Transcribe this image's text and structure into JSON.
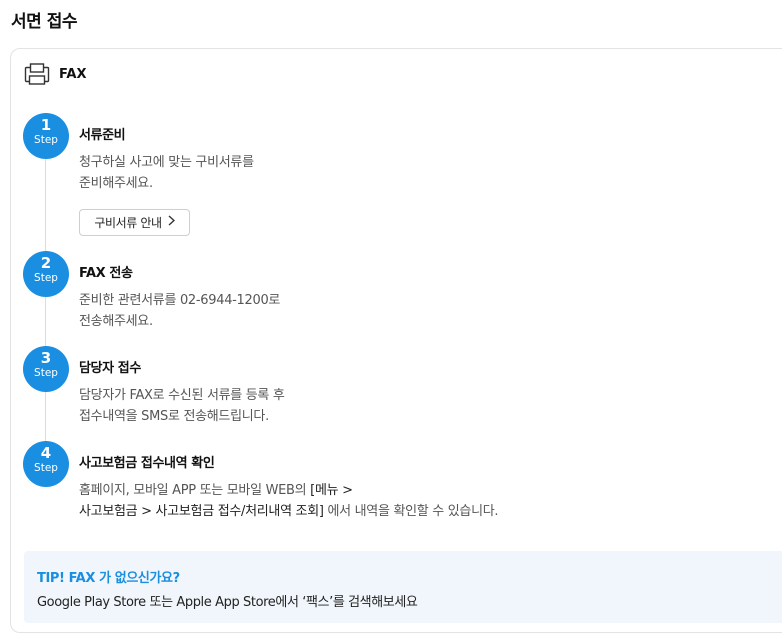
{
  "page": {
    "title": "서면 접수"
  },
  "fax": {
    "title": "FAX",
    "icon": "fax-icon"
  },
  "steps": [
    {
      "number": "1",
      "label": "Step",
      "title": "서류준비",
      "desc_lines": [
        "청구하실 사고에 맞는 구비서류를",
        "준비해주세요."
      ],
      "button_label": "구비서류 안내",
      "button_icon": "chevron-right-icon"
    },
    {
      "number": "2",
      "label": "Step",
      "title": "FAX 전송",
      "desc_lines": [
        "준비한 관련서류를 02-6944-1200로",
        "전송해주세요."
      ]
    },
    {
      "number": "3",
      "label": "Step",
      "title": "담당자 접수",
      "desc_lines": [
        "담당자가 FAX로 수신된 서류를 등록 후",
        "접수내역을 SMS로 전송해드립니다."
      ]
    },
    {
      "number": "4",
      "label": "Step",
      "title": "사고보험금 접수내역 확인",
      "desc_line1": "홈페이지, 모바일 APP 또는 모바일 WEB의 ",
      "desc_line1_path": "[메뉴 >",
      "desc_line2_path": "사고보험금 > 사고보험금 접수/처리내역 조회]",
      "desc_line2": " 에서 내역을 확인할 수 있습니다."
    }
  ],
  "tip": {
    "title": "TIP! FAX 가 없으신가요?",
    "text": "Google Play Store 또는 Apple App Store에서 ‘팩스’를 검색해보세요"
  },
  "colors": {
    "accent": "#1a8ee0",
    "tip_bg": "#f0f6fb"
  }
}
